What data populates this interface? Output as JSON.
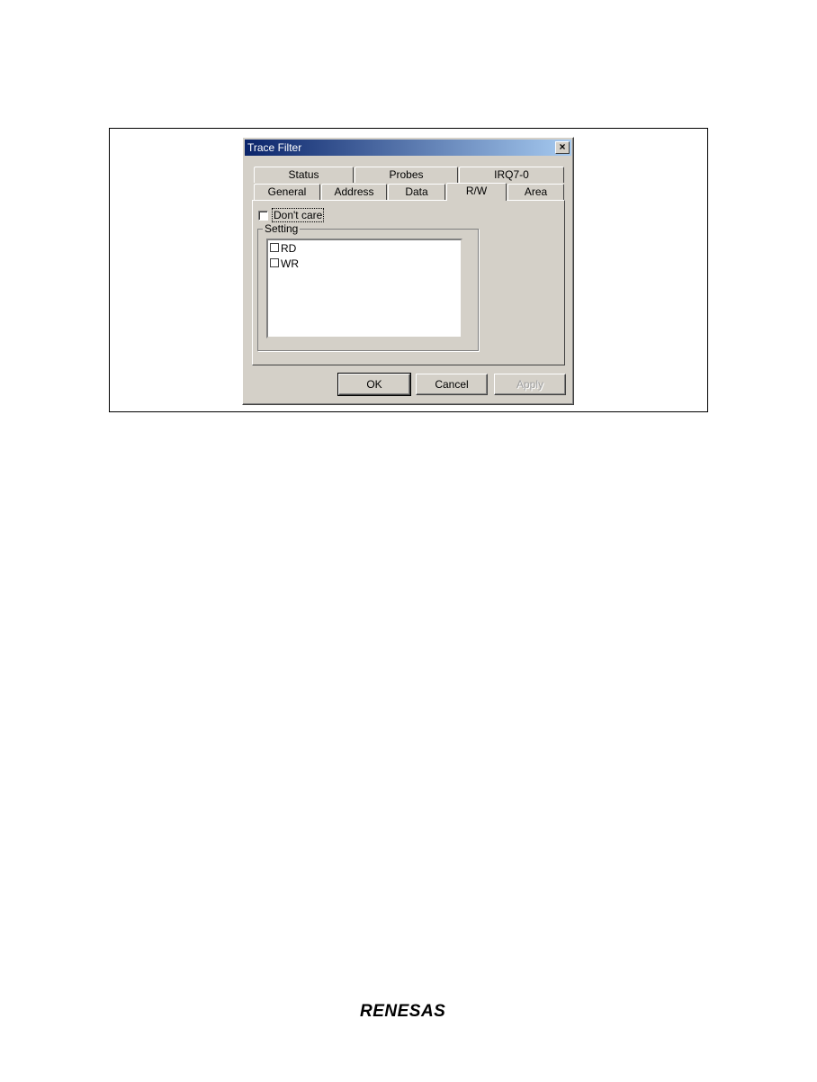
{
  "dialog": {
    "title": "Trace Filter",
    "close_glyph": "×",
    "tabs_back_row": [
      "Status",
      "Probes",
      "IRQ7-0"
    ],
    "tabs_front_row": [
      "General",
      "Address",
      "Data",
      "R/W",
      "Area"
    ],
    "active_tab": "R/W"
  },
  "rw_panel": {
    "dont_care_label": "Don't care",
    "dont_care_checked": false,
    "setting_group_label": "Setting",
    "items": [
      {
        "label": "RD",
        "checked": false
      },
      {
        "label": "WR",
        "checked": false
      }
    ]
  },
  "buttons": {
    "ok": "OK",
    "cancel": "Cancel",
    "apply": "Apply"
  },
  "footer": {
    "logo_text": "RENESAS"
  }
}
